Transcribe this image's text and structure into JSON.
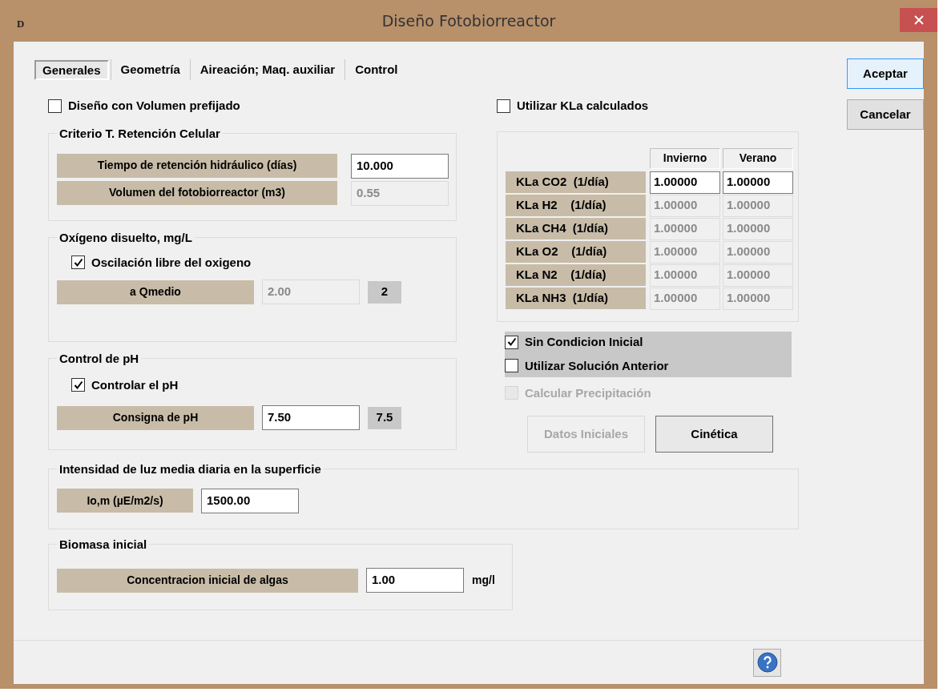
{
  "window": {
    "icon_text": "D",
    "title": "Diseño Fotobiorreactor"
  },
  "tabs": [
    {
      "label": "Generales",
      "selected": true
    },
    {
      "label": "Geometría",
      "selected": false
    },
    {
      "label": "Aireación; Maq. auxiliar",
      "selected": false
    },
    {
      "label": "Control",
      "selected": false
    }
  ],
  "dialog_buttons": [
    {
      "label": "Aceptar",
      "default": true
    },
    {
      "label": "Cancelar",
      "default": false
    }
  ],
  "volume_checkbox": {
    "label": "Diseño con Volumen prefijado",
    "checked": false
  },
  "retention_group": {
    "title": "Criterio T. Retención Celular",
    "rows": [
      {
        "label": "Tiempo de retención hidráulico (días)",
        "value": "10.000",
        "editable": true
      },
      {
        "label": "Volumen del fotobiorreactor (m3)",
        "value": "0.55",
        "editable": false
      }
    ]
  },
  "oxygen_group": {
    "title": "Oxígeno disuelto, mg/L",
    "checkbox": {
      "label": "Oscilación libre del oxigeno",
      "checked": true
    },
    "row": {
      "label": "a Qmedio",
      "value": "2.00",
      "editable": false,
      "readout": "2"
    }
  },
  "ph_group": {
    "title": "Control de pH",
    "checkbox": {
      "label": "Controlar el pH",
      "checked": true
    },
    "row": {
      "label": "Consigna de pH",
      "value": "7.50",
      "editable": true,
      "readout": "7.5"
    }
  },
  "light_group": {
    "title": "Intensidad de luz media diaria en la superficie",
    "row": {
      "label": "Io,m (µE/m2/s)",
      "value": "1500.00",
      "editable": true
    }
  },
  "biomass_group": {
    "title": "Biomasa inicial",
    "row": {
      "label": "Concentracion inicial de algas",
      "value": "1.00",
      "editable": true,
      "unit": "mg/l"
    }
  },
  "kla_checkbox": {
    "label": "Utilizar KLa calculados",
    "checked": false
  },
  "kla_table": {
    "columns": [
      "Invierno",
      "Verano"
    ],
    "rows": [
      {
        "label": "KLa CO2  (1/día)",
        "values": [
          "1.00000",
          "1.00000"
        ],
        "editable": true
      },
      {
        "label": "KLa H2    (1/día)",
        "values": [
          "1.00000",
          "1.00000"
        ],
        "editable": false
      },
      {
        "label": "KLa CH4  (1/día)",
        "values": [
          "1.00000",
          "1.00000"
        ],
        "editable": false
      },
      {
        "label": "KLa O2    (1/día)",
        "values": [
          "1.00000",
          "1.00000"
        ],
        "editable": false
      },
      {
        "label": "KLa N2    (1/día)",
        "values": [
          "1.00000",
          "1.00000"
        ],
        "editable": false
      },
      {
        "label": "KLa NH3  (1/día)",
        "values": [
          "1.00000",
          "1.00000"
        ],
        "editable": false
      }
    ]
  },
  "initial_options": [
    {
      "label": "Sin Condicion Inicial",
      "checked": true
    },
    {
      "label": "Utilizar Solución Anterior",
      "checked": false
    }
  ],
  "precipitation_checkbox": {
    "label": "Calcular Precipitación",
    "checked": false,
    "disabled": true
  },
  "action_buttons": [
    {
      "label": "Datos Iniciales",
      "disabled": true
    },
    {
      "label": "Cinética",
      "disabled": false
    }
  ]
}
